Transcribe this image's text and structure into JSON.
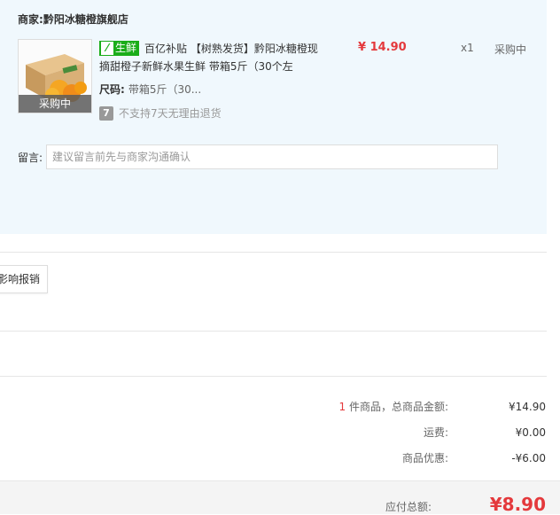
{
  "merchant": {
    "label": "商家:",
    "name": "黔阳冰糖橙旗舰店"
  },
  "item": {
    "tag": "生鲜",
    "title": "百亿补贴 【树熟发货】黔阳冰糖橙现摘甜橙子新鲜水果生鲜 带箱5斤（30个左",
    "price": "¥ 14.90",
    "qty": "x1",
    "status": "采购中",
    "thumb_badge": "采购中",
    "size_label": "尺码:",
    "size_value": "带箱5斤（30...",
    "return_icon": "7",
    "return_text": "不支持7天无理由退货"
  },
  "message": {
    "label": "留言:",
    "placeholder": "建议留言前先与商家沟通确认"
  },
  "reimburse_button": "影响报销",
  "summary": {
    "count": "1",
    "goods_label_suffix": " 件商品，总商品金额:",
    "goods_amount": "¥14.90",
    "shipping_label": "运费:",
    "shipping_amount": "¥0.00",
    "discount_label": "商品优惠:",
    "discount_amount": "-¥6.00"
  },
  "payment": {
    "label": "应付总额:",
    "amount": "¥8.90"
  },
  "colors": {
    "accent_red": "#e4393c",
    "fresh_green": "#1aad19",
    "panel_bg": "#f0f8fd"
  }
}
